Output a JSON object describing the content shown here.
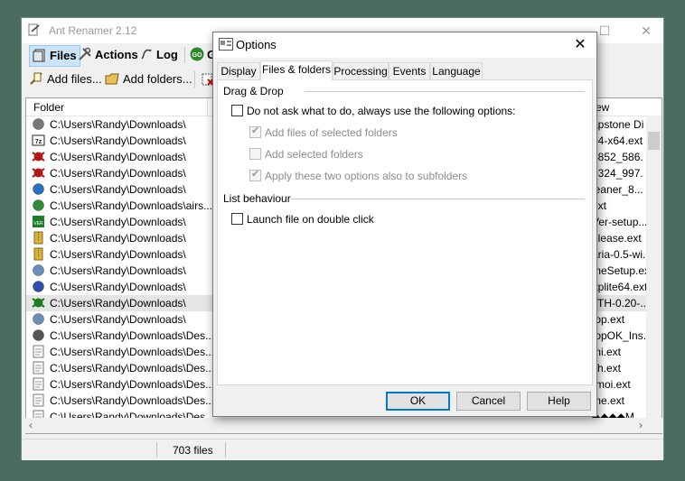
{
  "app": {
    "title": "Ant Renamer 2.12",
    "minimize": "—",
    "maximize": "☐",
    "close": "✕"
  },
  "toolbar": {
    "files_label": "Files",
    "actions_label": "Actions",
    "log_label": "Log",
    "go_label": "G",
    "add_files_label": "Add files...",
    "add_folders_label": "Add folders..."
  },
  "list": {
    "header_folder": "Folder",
    "header_new": "ew",
    "rows": [
      {
        "icon": "setup-icon",
        "path": "C:\\Users\\Randy\\Downloads\\",
        "name": "apstone Di"
      },
      {
        "icon": "7z-icon",
        "path": "C:\\Users\\Randy\\Downloads\\",
        "name": "04-x64.ext"
      },
      {
        "icon": "bug-icon",
        "path": "C:\\Users\\Randy\\Downloads\\",
        "name": "4852_586."
      },
      {
        "icon": "bug-icon",
        "path": "C:\\Users\\Randy\\Downloads\\",
        "name": "0324_997."
      },
      {
        "icon": "ccleaner-icon",
        "path": "C:\\Users\\Randy\\Downloads\\",
        "name": "leaner_8..."
      },
      {
        "icon": "globe-icon",
        "path": "C:\\Users\\Randy\\Downloads\\airs...",
        "name": "ext"
      },
      {
        "icon": "ver-icon",
        "path": "C:\\Users\\Randy\\Downloads\\",
        "name": "Ver-setup..."
      },
      {
        "icon": "zip-icon",
        "path": "C:\\Users\\Randy\\Downloads\\",
        "name": "elease.ext"
      },
      {
        "icon": "zip-icon",
        "path": "C:\\Users\\Randy\\Downloads\\",
        "name": "aria-0.5-wi..."
      },
      {
        "icon": "installer-icon",
        "path": "C:\\Users\\Randy\\Downloads\\",
        "name": "meSetup.ext"
      },
      {
        "icon": "pen-icon",
        "path": "C:\\Users\\Randy\\Downloads\\",
        "name": "ftplite64.ext"
      },
      {
        "icon": "clover-icon",
        "path": "C:\\Users\\Randy\\Downloads\\",
        "name": "xTH-0.20-..."
      },
      {
        "icon": "installer-icon",
        "path": "C:\\Users\\Randy\\Downloads\\",
        "name": "top.ext"
      },
      {
        "icon": "grid-icon",
        "path": "C:\\Users\\Randy\\Downloads\\Des...",
        "name": "topOK_Ins..."
      },
      {
        "icon": "document-icon",
        "path": "C:\\Users\\Randy\\Downloads\\Des...",
        "name": "mi.ext"
      },
      {
        "icon": "document-icon",
        "path": "C:\\Users\\Randy\\Downloads\\Des...",
        "name": "ch.ext"
      },
      {
        "icon": "document-icon",
        "path": "C:\\Users\\Randy\\Downloads\\Des...",
        "name": "-moi.ext"
      },
      {
        "icon": "document-icon",
        "path": "C:\\Users\\Randy\\Downloads\\Des...",
        "name": "me.ext"
      },
      {
        "icon": "document-icon",
        "path": "C:\\Users\\Randy\\Downloads\\Des...",
        "name": "◆◆◆◆M..."
      }
    ],
    "selected_index": 11
  },
  "status": {
    "count": "703 files"
  },
  "dialog": {
    "title": "Options",
    "close": "✕",
    "tabs": [
      {
        "label": "Display",
        "active": false
      },
      {
        "label": "Files & folders",
        "active": true
      },
      {
        "label": "Processing",
        "active": false
      },
      {
        "label": "Events",
        "active": false
      },
      {
        "label": "Language",
        "active": false
      }
    ],
    "drag_drop": {
      "heading": "Drag & Drop",
      "do_not_ask": {
        "label": "Do not ask what to do, always use the following options:",
        "checked": false
      },
      "add_files": {
        "label": "Add files of selected folders",
        "checked": true,
        "disabled": true
      },
      "add_selected": {
        "label": "Add selected folders",
        "checked": false,
        "disabled": true
      },
      "apply_sub": {
        "label": "Apply these two options also to subfolders",
        "checked": true,
        "disabled": true
      }
    },
    "list_behaviour": {
      "heading": "List behaviour",
      "launch": {
        "label": "Launch file on double click",
        "checked": false
      }
    },
    "buttons": {
      "ok": "OK",
      "cancel": "Cancel",
      "help": "Help"
    }
  },
  "colors": {
    "desktop": "#4b6d60",
    "accent": "#0078d7",
    "selected_row": "#e5e5e5"
  }
}
